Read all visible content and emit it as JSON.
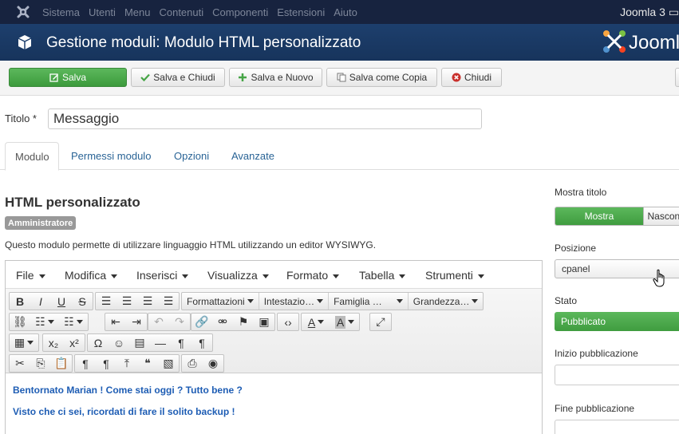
{
  "topnav": {
    "menu": [
      "Sistema",
      "Utenti",
      "Menu",
      "Contenuti",
      "Componenti",
      "Estensioni",
      "Aiuto"
    ],
    "brand": "Joomla 3"
  },
  "header": {
    "title": "Gestione moduli: Modulo HTML personalizzato",
    "logo_text": "Joomla"
  },
  "toolbar": {
    "save": "Salva",
    "save_close": "Salva e Chiudi",
    "save_new": "Salva e Nuovo",
    "save_copy": "Salva come Copia",
    "close": "Chiudi"
  },
  "form": {
    "title_label": "Titolo *",
    "title_value": "Messaggio"
  },
  "tabs": [
    "Modulo",
    "Permessi modulo",
    "Opzioni",
    "Avanzate"
  ],
  "module": {
    "heading": "HTML personalizzato",
    "badge": "Amministratore",
    "description": "Questo modulo permette di utilizzare linguaggio HTML utilizzando un editor WYSIWYG."
  },
  "editor": {
    "menu": [
      "File",
      "Modifica",
      "Inserisci",
      "Visualizza",
      "Formato",
      "Tabella",
      "Strumenti"
    ],
    "selects": [
      "Formattazioni",
      "Intestazio…",
      "Famiglia …",
      "Grandezza…"
    ],
    "content": [
      "Bentornato Marian ! Come stai oggi ? Tutto bene ?",
      "Visto che ci sei, ricordati di fare il solito backup !"
    ]
  },
  "sidebar": {
    "show_title_label": "Mostra titolo",
    "show_title_on": "Mostra",
    "show_title_off": "Nascondi",
    "position_label": "Posizione",
    "position_value": "cpanel",
    "status_label": "Stato",
    "status_value": "Pubblicato",
    "publish_up_label": "Inizio pubblicazione",
    "publish_down_label": "Fine pubblicazione"
  },
  "colors": {
    "topnav_bg": "#17233f",
    "header_bg": "#1d3f6d",
    "success": "#46a546",
    "link": "#2a6496",
    "editor_text": "#1e5db4"
  }
}
